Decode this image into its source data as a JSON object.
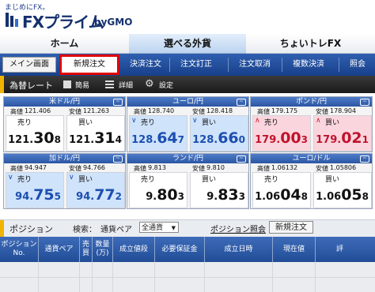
{
  "header": {
    "tagline": "まじめにFX。",
    "brand": "FXプライム",
    "brand_sub": "byGMO"
  },
  "nav": {
    "home": "ホーム",
    "choose": "選べる外貨",
    "trade": "ちょいトレFX"
  },
  "subnav": {
    "items": [
      "メイン画面",
      "新規注文",
      "決済注文",
      "注文訂正",
      "注文取消",
      "複数決済",
      "照会"
    ],
    "highlighted": "新規注文",
    "highlight_color": "#e00000"
  },
  "ratebar": {
    "title": "為替レート",
    "simple": "簡易",
    "detail": "詳細",
    "settings": "設定"
  },
  "labels": {
    "high": "高値",
    "low": "安値",
    "sell": "売り",
    "buy": "買い"
  },
  "rates": [
    {
      "pair": "米ドル/円",
      "high": "121.406",
      "low": "121.263",
      "sell": {
        "a": "121.",
        "b": "30",
        "c": "8",
        "dir": "none"
      },
      "buy": {
        "a": "121.",
        "b": "31",
        "c": "4",
        "dir": "none"
      }
    },
    {
      "pair": "ユーロ/円",
      "high": "128.740",
      "low": "128.418",
      "sell": {
        "a": "128.",
        "b": "64",
        "c": "7",
        "dir": "up"
      },
      "buy": {
        "a": "128.",
        "b": "66",
        "c": "0",
        "dir": "up"
      }
    },
    {
      "pair": "ポンド/円",
      "high": "179.175",
      "low": "178.904",
      "sell": {
        "a": "179.",
        "b": "00",
        "c": "3",
        "dir": "down"
      },
      "buy": {
        "a": "179.",
        "b": "02",
        "c": "1",
        "dir": "down"
      }
    },
    {
      "pair": "加ドル/円",
      "high": "94.947",
      "low": "94.766",
      "sell": {
        "a": "94.",
        "b": "75",
        "c": "5",
        "dir": "up"
      },
      "buy": {
        "a": "94.",
        "b": "77",
        "c": "2",
        "dir": "up"
      }
    },
    {
      "pair": "ランド/円",
      "high": "9.813",
      "low": "9.810",
      "sell": {
        "a": "9.",
        "b": "80",
        "c": "3",
        "dir": "none"
      },
      "buy": {
        "a": "9.",
        "b": "83",
        "c": "3",
        "dir": "none"
      }
    },
    {
      "pair": "ユーロ/ドル",
      "high": "1.06132",
      "low": "1.05806",
      "sell": {
        "a": "1.06",
        "b": "04",
        "c": "8",
        "dir": "none"
      },
      "buy": {
        "a": "1.06",
        "b": "05",
        "c": "8",
        "dir": "none"
      }
    }
  ],
  "colors": {
    "up": "#1d4fb0",
    "down": "#c0142d"
  },
  "position": {
    "title": "ポジション",
    "search_label": "検索：",
    "pair_label": "通貨ペア",
    "select_value": "全通貨",
    "link": "ポジション照会",
    "new_order": "新規注文"
  },
  "table": {
    "columns": [
      "ポジション\nNo.",
      "通貨ペア",
      "売\n買",
      "数量\n(万)",
      "成立値段",
      "必要保証金",
      "成立日時",
      "現在値",
      "評"
    ]
  }
}
